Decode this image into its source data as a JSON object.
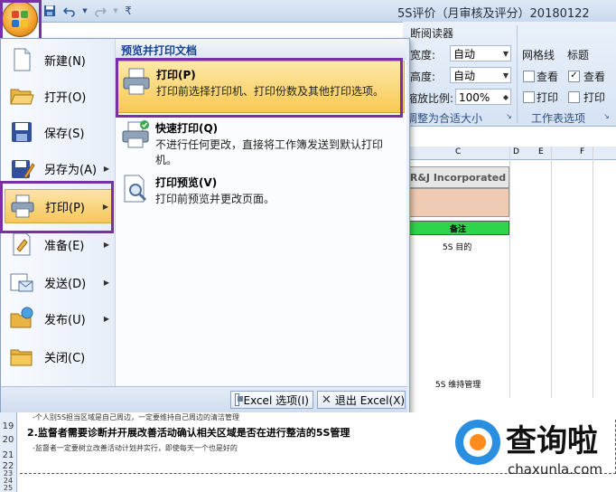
{
  "window": {
    "title": "5S评价（月审核及评分）20180122"
  },
  "qat": {
    "save_icon": "save-icon",
    "undo_icon": "undo-icon",
    "redo_icon": "redo-icon",
    "customize": "₹"
  },
  "ribbon": {
    "group_label": "断阅读器",
    "width_label": "宽度:",
    "width_value": "自动",
    "height_label": "高度:",
    "height_value": "自动",
    "scale_label": "缩放比例:",
    "scale_value": "100%",
    "fit_group": "调整为合适大小",
    "gridlines_header": "网格线",
    "headings_header": "标题",
    "grid_view": "查看",
    "grid_print": "打印",
    "head_view": "查看",
    "head_print": "打印",
    "sheet_options_group": "工作表选项",
    "grid_view_checked": false,
    "grid_print_checked": false,
    "head_view_checked": true,
    "head_print_checked": false
  },
  "sheet": {
    "col_c": "C",
    "col_d": "D",
    "col_e": "E",
    "col_f": "F",
    "company": "R&J Incorporated",
    "remark": "备注",
    "goal": "5S 目的",
    "maintain": "5S 维持管理"
  },
  "menu": {
    "left_items": [
      {
        "label": "新建(N)",
        "icon": "new-document-icon"
      },
      {
        "label": "打开(O)",
        "icon": "open-folder-icon"
      },
      {
        "label": "保存(S)",
        "icon": "save-icon"
      },
      {
        "label": "另存为(A)",
        "icon": "save-as-icon"
      },
      {
        "label": "打印(P)",
        "icon": "printer-icon"
      },
      {
        "label": "准备(E)",
        "icon": "prepare-icon"
      },
      {
        "label": "发送(D)",
        "icon": "send-icon"
      },
      {
        "label": "发布(U)",
        "icon": "publish-icon"
      },
      {
        "label": "关闭(C)",
        "icon": "close-folder-icon"
      }
    ],
    "right_header": "预览并打印文档",
    "right_items": [
      {
        "title": "打印(P)",
        "desc": "打印前选择打印机、打印份数及其他打印选项。",
        "icon": "printer-icon"
      },
      {
        "title": "快速打印(Q)",
        "desc": "不进行任何更改，直接将工作簿发送到默认打印机。",
        "icon": "quick-print-icon"
      },
      {
        "title": "打印预览(V)",
        "desc": "打印前预览并更改页面。",
        "icon": "print-preview-icon"
      }
    ],
    "options_button": "Excel 选项(I)",
    "exit_button": "退出 Excel(X)"
  },
  "rows": {
    "r18_text": "-个人别5S担当区域是自己周边，一定要维持自己周边的清洁管理",
    "r20_text": "2.监督者需要诊断并开展改善活动确认相关区域是否在进行整洁的5S管理",
    "r21_text": "-监督者一定要树立改善活动计划并实行，即使每天一个也是好的",
    "row_numbers": [
      "19",
      "20",
      "21",
      "22",
      "23",
      "24",
      "25"
    ]
  },
  "watermark": {
    "brand": "查询啦",
    "url": "chaxunla.com"
  },
  "colors": {
    "highlight": "#7a2fa7",
    "selected_item": "#fdd463",
    "header_blue": "#15428b",
    "remark_green": "#2fd44a",
    "peach": "#efcbb4"
  }
}
